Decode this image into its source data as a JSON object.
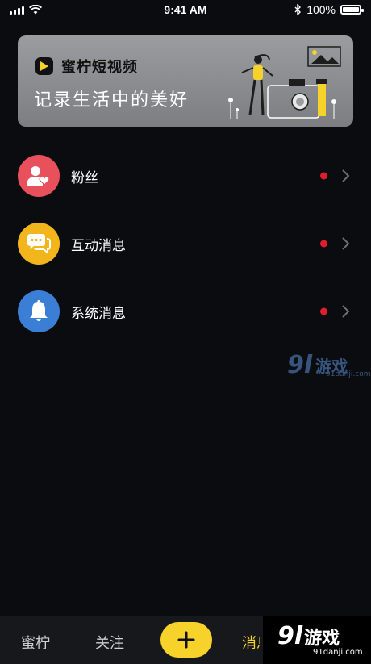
{
  "status_bar": {
    "time": "9:41 AM",
    "battery": "100%",
    "battery_level": 1.0
  },
  "banner": {
    "brand": "蜜柠短视频",
    "tagline": "记录生活中的美好",
    "accent": "#f6d22b"
  },
  "messages": [
    {
      "label": "粉丝",
      "icon": "fans-icon",
      "color": "#e8505b",
      "unread": true
    },
    {
      "label": "互动消息",
      "icon": "chat-icon",
      "color": "#f2b51c",
      "unread": true
    },
    {
      "label": "系统消息",
      "icon": "bell-icon",
      "color": "#3a7fd5",
      "unread": true
    }
  ],
  "watermark_mid": {
    "num": "9l",
    "text": "游戏",
    "site": "91danji.com"
  },
  "tabbar": {
    "tabs": [
      "蜜柠",
      "关注"
    ],
    "partial_tab": "消息",
    "add_icon": "plus-icon"
  },
  "watermark_bottom": {
    "num": "9l",
    "text": "游戏",
    "site": "91danji.com"
  }
}
